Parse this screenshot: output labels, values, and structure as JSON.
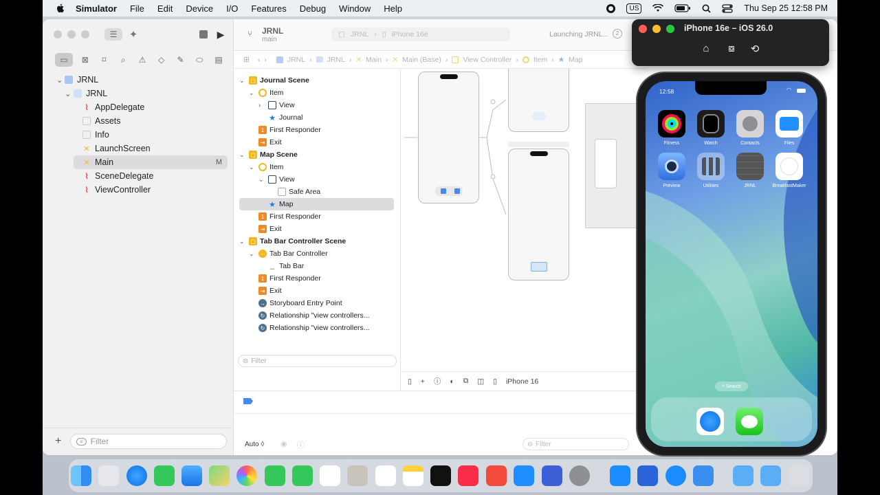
{
  "menubar": {
    "app_name": "Simulator",
    "items": [
      "File",
      "Edit",
      "Device",
      "I/O",
      "Features",
      "Debug",
      "Window",
      "Help"
    ],
    "input_source": "US",
    "datetime": "Thu Sep 25  12:58 PM"
  },
  "xcode": {
    "project_name": "JRNL",
    "branch": "main",
    "scheme": "JRNL",
    "destination": "iPhone 16e",
    "status": "Launching JRNL...",
    "navigator": {
      "root": "JRNL",
      "group": "JRNL",
      "files": [
        "AppDelegate",
        "Assets",
        "Info",
        "LaunchScreen",
        "Main",
        "SceneDelegate",
        "ViewController"
      ],
      "selected": "Main",
      "badge": "M",
      "filter_placeholder": "Filter"
    },
    "jump_bar": [
      "JRNL",
      "JRNL",
      "Main",
      "Main (Base)",
      "View Controller",
      "Item",
      "Map"
    ],
    "outline": {
      "items": [
        "Journal Scene",
        "Item",
        "View",
        "Journal",
        "First Responder",
        "Exit",
        "Map Scene",
        "Item",
        "View",
        "Safe Area",
        "Map",
        "First Responder",
        "Exit",
        "Tab Bar Controller Scene",
        "Tab Bar Controller",
        "Tab Bar",
        "First Responder",
        "Exit",
        "Storyboard Entry Point",
        "Relationship \"view controllers...",
        "Relationship \"view controllers..."
      ],
      "filter_placeholder": "Filter"
    },
    "canvas_device": "iPhone 16",
    "debug": {
      "auto_label": "Auto ◊",
      "filter_placeholder": "Filter"
    }
  },
  "simulator": {
    "title": "iPhone 16e – iOS 26.0",
    "time": "12:58",
    "apps": [
      "Fitness",
      "Watch",
      "Contacts",
      "Files",
      "Preview",
      "Utilities",
      "JRNL",
      "BreakfastMaker"
    ],
    "search_label": "Search"
  },
  "colors": {
    "accent": "#1f7ae0",
    "scene_yellow": "#f2b81f",
    "responder_orange": "#f08a24"
  }
}
